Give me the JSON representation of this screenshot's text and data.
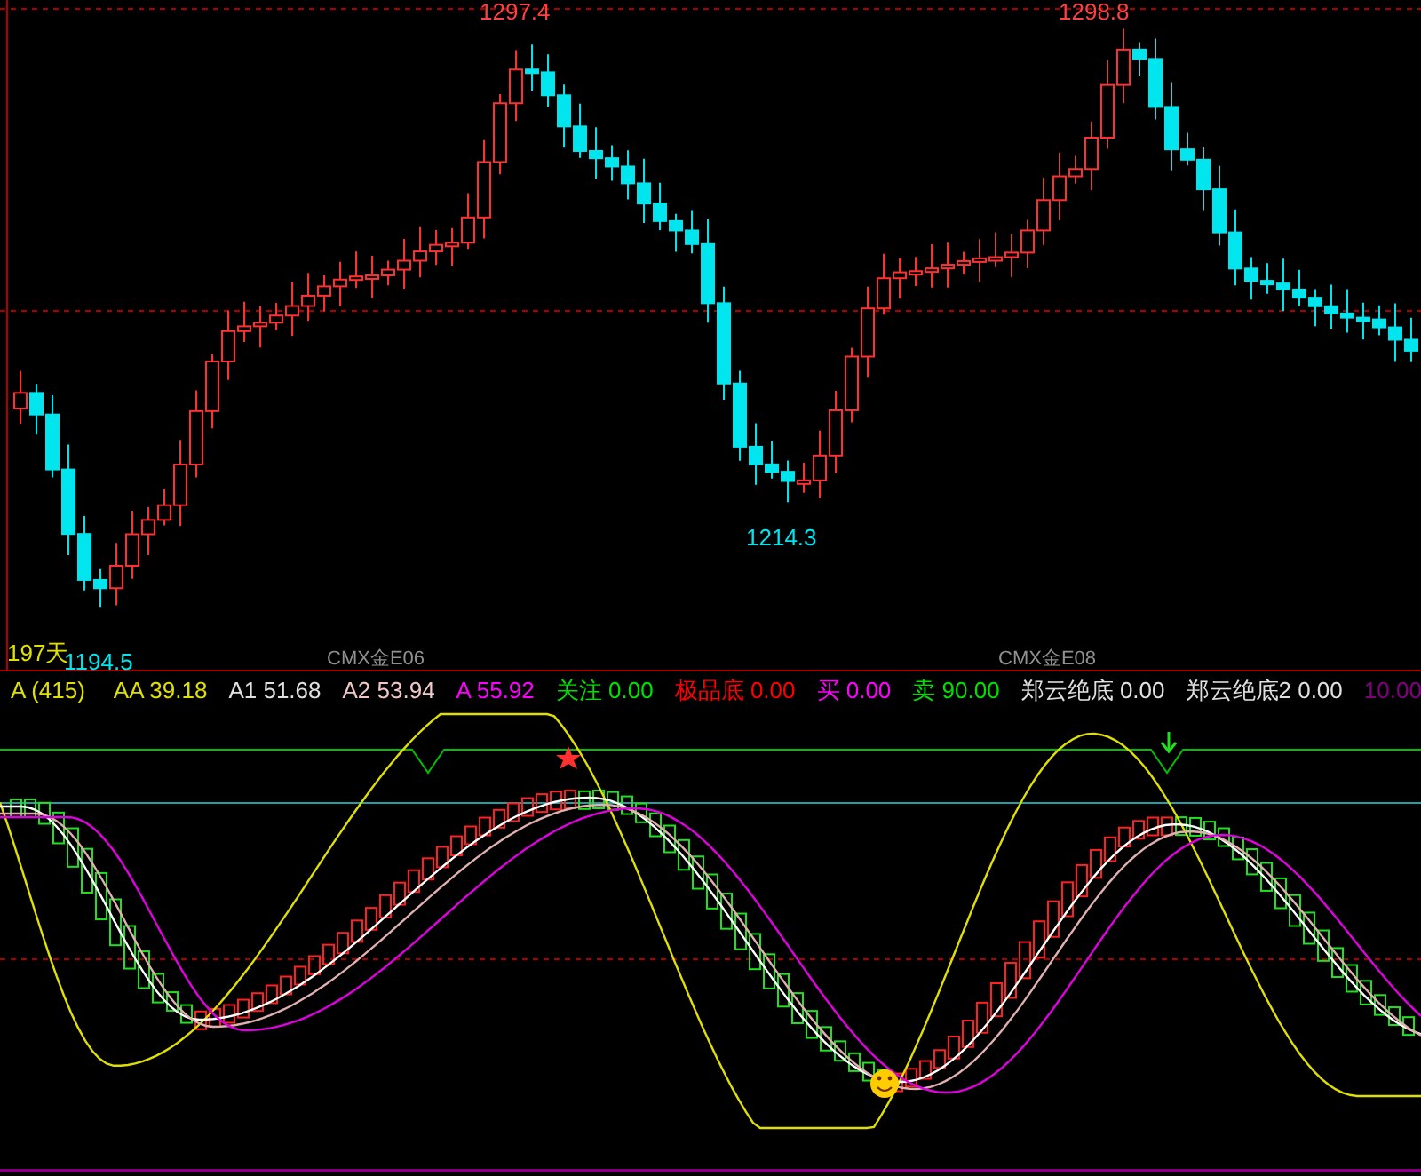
{
  "price_chart": {
    "high_labels": [
      {
        "text": "1297.4"
      },
      {
        "text": "1298.8"
      }
    ],
    "low_labels": [
      {
        "text": "1194.5"
      },
      {
        "text": "1214.3"
      }
    ],
    "period_label": "197天",
    "contract_labels": [
      "CMX金E06",
      "CMX金E08"
    ]
  },
  "indicator_bar": [
    {
      "kind": "selector",
      "label": "A (415)",
      "color": "#e0e000"
    },
    {
      "kind": "value",
      "label": "AA",
      "value": "39.18",
      "color": "#e0e000"
    },
    {
      "kind": "value",
      "label": "A1",
      "value": "51.68",
      "color": "#e0e0e0"
    },
    {
      "kind": "value",
      "label": "A2",
      "value": "53.94",
      "color": "#f0c8c8"
    },
    {
      "kind": "value",
      "label": "A",
      "value": "55.92",
      "color": "#ff00ff"
    },
    {
      "kind": "value",
      "label": "关注",
      "value": "0.00",
      "color": "#00e000"
    },
    {
      "kind": "value",
      "label": "极品底",
      "value": "0.00",
      "color": "#ff0000"
    },
    {
      "kind": "value",
      "label": "买",
      "value": "0.00",
      "color": "#ff00ff"
    },
    {
      "kind": "value",
      "label": "卖",
      "value": "90.00",
      "color": "#00e000"
    },
    {
      "kind": "value",
      "label": "郑云绝底",
      "value": "0.00",
      "color": "#e0e0e0"
    },
    {
      "kind": "value",
      "label": "郑云绝底2",
      "value": "0.00",
      "color": "#e0e0e0"
    },
    {
      "kind": "value",
      "value": "10.00",
      "color": "#800080"
    }
  ]
}
